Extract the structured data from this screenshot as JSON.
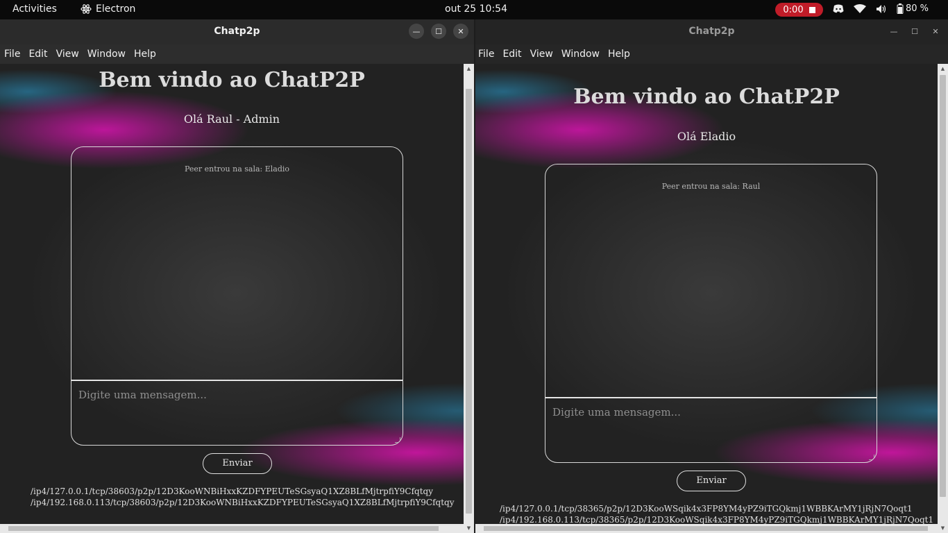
{
  "topbar": {
    "activities": "Activities",
    "app_name": "Electron",
    "clock": "out 25  10:54",
    "recording": "0:00",
    "battery": "80 %"
  },
  "window_left": {
    "title": "Chatp2p",
    "menu": [
      "File",
      "Edit",
      "View",
      "Window",
      "Help"
    ],
    "page_title": "Bem vindo ao ChatP2P",
    "greeting": "Olá Raul - Admin",
    "system_message": "Peer entrou na sala: Eladio",
    "message_placeholder": "Digite uma mensagem...",
    "send_label": "Enviar",
    "addresses": [
      "/ip4/127.0.0.1/tcp/38603/p2p/12D3KooWNBiHxxKZDFYPEUTeSGsyaQ1XZ8BLfMjtrpfiY9Cfqtqy",
      "/ip4/192.168.0.113/tcp/38603/p2p/12D3KooWNBiHxxKZDFYPEUTeSGsyaQ1XZ8BLfMjtrpfiY9Cfqtqy"
    ]
  },
  "window_right": {
    "title": "Chatp2p",
    "menu": [
      "File",
      "Edit",
      "View",
      "Window",
      "Help"
    ],
    "page_title": "Bem vindo ao ChatP2P",
    "greeting": "Olá Eladio",
    "system_message": "Peer entrou na sala: Raul",
    "message_placeholder": "Digite uma mensagem...",
    "send_label": "Enviar",
    "addresses": [
      "/ip4/127.0.0.1/tcp/38365/p2p/12D3KooWSqik4x3FP8YM4yPZ9iTGQkmj1WBBKArMY1jRjN7Qoqt1",
      "/ip4/192.168.0.113/tcp/38365/p2p/12D3KooWSqik4x3FP8YM4yPZ9iTGQkmj1WBBKArMY1jRjN7Qoqt1"
    ]
  },
  "colors": {
    "accent_magenta": "#d714af",
    "accent_blue": "#2882aa",
    "record_red": "#c01c28"
  }
}
